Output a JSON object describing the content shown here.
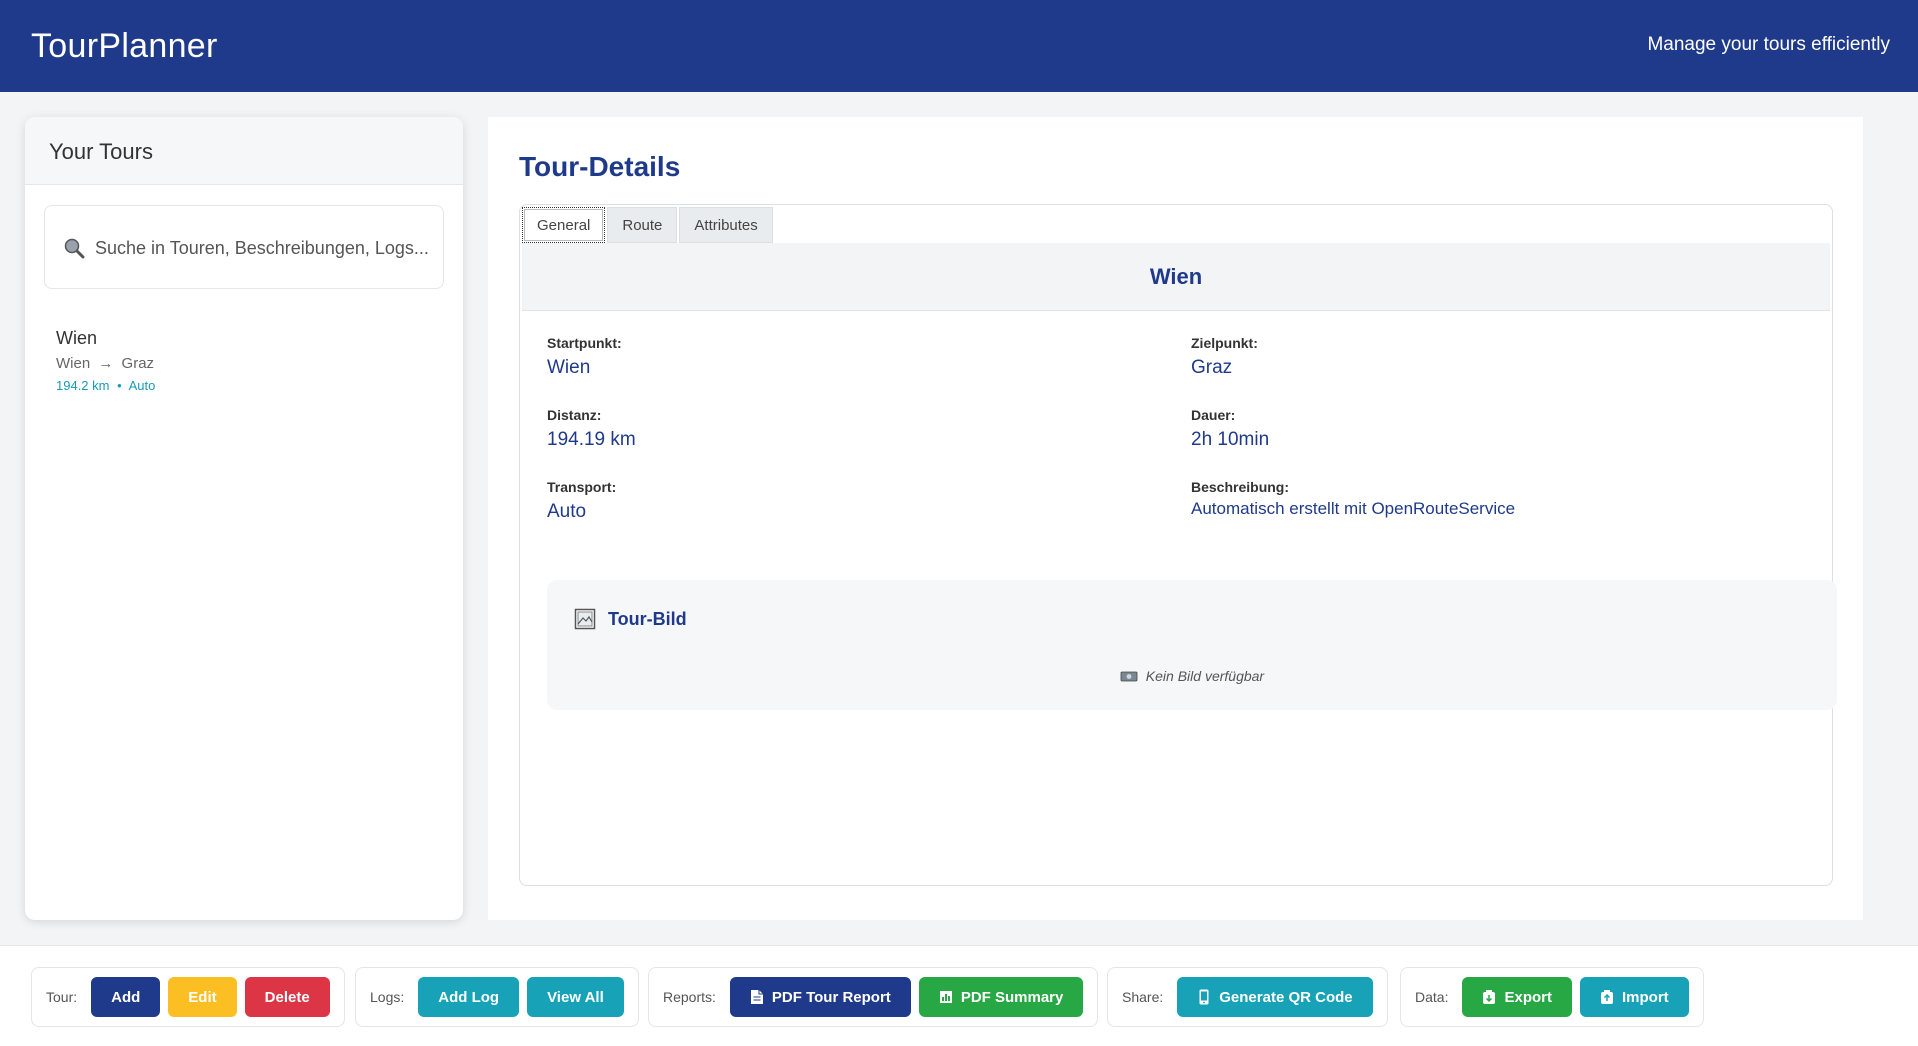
{
  "header": {
    "title": "TourPlanner",
    "subtitle": "Manage your tours efficiently"
  },
  "sidebar": {
    "title": "Your Tours",
    "search_placeholder": "Suche in Touren, Beschreibungen, Logs...",
    "tours": [
      {
        "name": "Wien",
        "from": "Wien",
        "to": "Graz",
        "arrow": "→",
        "distance": "194.2 km",
        "sep": "•",
        "transport": "Auto"
      }
    ]
  },
  "main": {
    "title": "Tour-Details",
    "tabs": [
      "General",
      "Route",
      "Attributes"
    ],
    "active_tab": "General",
    "tour_name": "Wien",
    "fields": {
      "start_label": "Startpunkt:",
      "start_value": "Wien",
      "end_label": "Zielpunkt:",
      "end_value": "Graz",
      "distance_label": "Distanz:",
      "distance_value": "194.19 km",
      "duration_label": "Dauer:",
      "duration_value": "2h 10min",
      "transport_label": "Transport:",
      "transport_value": "Auto",
      "description_label": "Beschreibung:",
      "description_value": "Automatisch erstellt mit OpenRouteService"
    },
    "image_section": {
      "title": "Tour-Bild",
      "empty_text": "Kein Bild verfügbar"
    }
  },
  "footer": {
    "tour": {
      "label": "Tour:",
      "add": "Add",
      "edit": "Edit",
      "delete": "Delete"
    },
    "logs": {
      "label": "Logs:",
      "add_log": "Add Log",
      "view_all": "View All"
    },
    "reports": {
      "label": "Reports:",
      "pdf_tour_report": "PDF Tour Report",
      "pdf_summary": "PDF Summary"
    },
    "share": {
      "label": "Share:",
      "generate_qr": "Generate QR Code"
    },
    "data": {
      "label": "Data:",
      "export": "Export",
      "import": "Import"
    }
  },
  "colors": {
    "brand": "#1f3a8a",
    "teal": "#17a2b8",
    "green": "#28a745",
    "yellow": "#fbbf24",
    "red": "#dc3545"
  }
}
